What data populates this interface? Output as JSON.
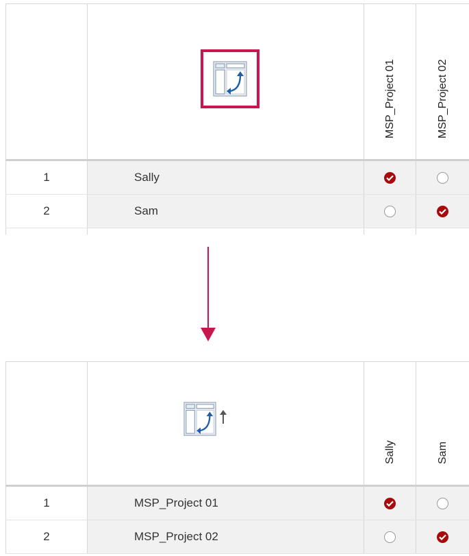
{
  "top_table": {
    "columns": [
      "MSP_Project 01",
      "MSP_Project 02"
    ],
    "rows": [
      {
        "num": "1",
        "name": "Sally",
        "checks": [
          true,
          false
        ]
      },
      {
        "num": "2",
        "name": "Sam",
        "checks": [
          false,
          true
        ]
      }
    ]
  },
  "bottom_table": {
    "columns": [
      "Sally",
      "Sam"
    ],
    "rows": [
      {
        "num": "1",
        "name": "MSP_Project 01",
        "checks": [
          true,
          false
        ]
      },
      {
        "num": "2",
        "name": "MSP_Project 02",
        "checks": [
          false,
          true
        ]
      }
    ]
  },
  "colors": {
    "highlight": "#c8174f",
    "check": "#a60a0a",
    "flow_arrow": "#c8174f",
    "grid_line": "#d6d6d6",
    "row_shade": "#f1f1f1"
  },
  "icons": {
    "pivot": "pivot-table-icon",
    "sort": "sort-ascending-icon",
    "flow": "arrow-down-icon",
    "check": "check-circle-icon",
    "radio": "radio-empty-icon"
  }
}
